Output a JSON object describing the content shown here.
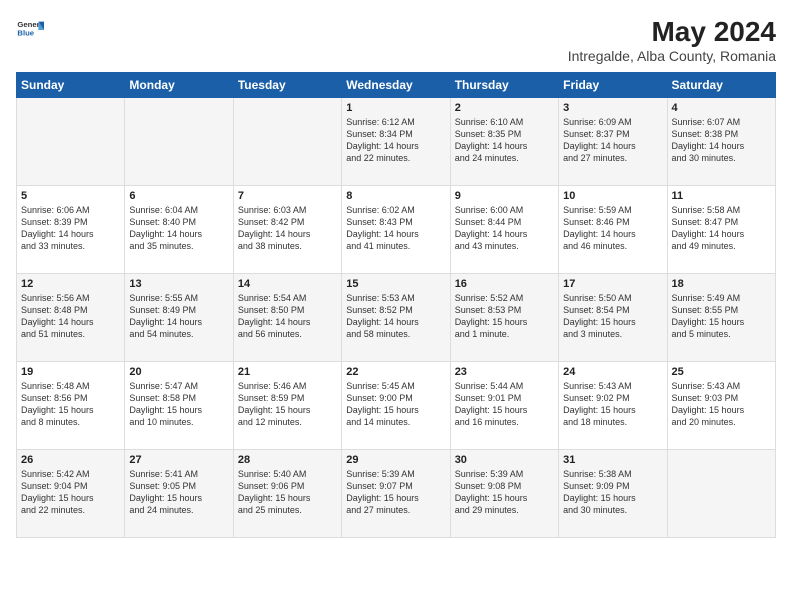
{
  "header": {
    "logo_general": "General",
    "logo_blue": "Blue",
    "title": "May 2024",
    "location": "Intregalde, Alba County, Romania"
  },
  "days_of_week": [
    "Sunday",
    "Monday",
    "Tuesday",
    "Wednesday",
    "Thursday",
    "Friday",
    "Saturday"
  ],
  "weeks": [
    [
      {
        "day": "",
        "info": ""
      },
      {
        "day": "",
        "info": ""
      },
      {
        "day": "",
        "info": ""
      },
      {
        "day": "1",
        "info": "Sunrise: 6:12 AM\nSunset: 8:34 PM\nDaylight: 14 hours\nand 22 minutes."
      },
      {
        "day": "2",
        "info": "Sunrise: 6:10 AM\nSunset: 8:35 PM\nDaylight: 14 hours\nand 24 minutes."
      },
      {
        "day": "3",
        "info": "Sunrise: 6:09 AM\nSunset: 8:37 PM\nDaylight: 14 hours\nand 27 minutes."
      },
      {
        "day": "4",
        "info": "Sunrise: 6:07 AM\nSunset: 8:38 PM\nDaylight: 14 hours\nand 30 minutes."
      }
    ],
    [
      {
        "day": "5",
        "info": "Sunrise: 6:06 AM\nSunset: 8:39 PM\nDaylight: 14 hours\nand 33 minutes."
      },
      {
        "day": "6",
        "info": "Sunrise: 6:04 AM\nSunset: 8:40 PM\nDaylight: 14 hours\nand 35 minutes."
      },
      {
        "day": "7",
        "info": "Sunrise: 6:03 AM\nSunset: 8:42 PM\nDaylight: 14 hours\nand 38 minutes."
      },
      {
        "day": "8",
        "info": "Sunrise: 6:02 AM\nSunset: 8:43 PM\nDaylight: 14 hours\nand 41 minutes."
      },
      {
        "day": "9",
        "info": "Sunrise: 6:00 AM\nSunset: 8:44 PM\nDaylight: 14 hours\nand 43 minutes."
      },
      {
        "day": "10",
        "info": "Sunrise: 5:59 AM\nSunset: 8:46 PM\nDaylight: 14 hours\nand 46 minutes."
      },
      {
        "day": "11",
        "info": "Sunrise: 5:58 AM\nSunset: 8:47 PM\nDaylight: 14 hours\nand 49 minutes."
      }
    ],
    [
      {
        "day": "12",
        "info": "Sunrise: 5:56 AM\nSunset: 8:48 PM\nDaylight: 14 hours\nand 51 minutes."
      },
      {
        "day": "13",
        "info": "Sunrise: 5:55 AM\nSunset: 8:49 PM\nDaylight: 14 hours\nand 54 minutes."
      },
      {
        "day": "14",
        "info": "Sunrise: 5:54 AM\nSunset: 8:50 PM\nDaylight: 14 hours\nand 56 minutes."
      },
      {
        "day": "15",
        "info": "Sunrise: 5:53 AM\nSunset: 8:52 PM\nDaylight: 14 hours\nand 58 minutes."
      },
      {
        "day": "16",
        "info": "Sunrise: 5:52 AM\nSunset: 8:53 PM\nDaylight: 15 hours\nand 1 minute."
      },
      {
        "day": "17",
        "info": "Sunrise: 5:50 AM\nSunset: 8:54 PM\nDaylight: 15 hours\nand 3 minutes."
      },
      {
        "day": "18",
        "info": "Sunrise: 5:49 AM\nSunset: 8:55 PM\nDaylight: 15 hours\nand 5 minutes."
      }
    ],
    [
      {
        "day": "19",
        "info": "Sunrise: 5:48 AM\nSunset: 8:56 PM\nDaylight: 15 hours\nand 8 minutes."
      },
      {
        "day": "20",
        "info": "Sunrise: 5:47 AM\nSunset: 8:58 PM\nDaylight: 15 hours\nand 10 minutes."
      },
      {
        "day": "21",
        "info": "Sunrise: 5:46 AM\nSunset: 8:59 PM\nDaylight: 15 hours\nand 12 minutes."
      },
      {
        "day": "22",
        "info": "Sunrise: 5:45 AM\nSunset: 9:00 PM\nDaylight: 15 hours\nand 14 minutes."
      },
      {
        "day": "23",
        "info": "Sunrise: 5:44 AM\nSunset: 9:01 PM\nDaylight: 15 hours\nand 16 minutes."
      },
      {
        "day": "24",
        "info": "Sunrise: 5:43 AM\nSunset: 9:02 PM\nDaylight: 15 hours\nand 18 minutes."
      },
      {
        "day": "25",
        "info": "Sunrise: 5:43 AM\nSunset: 9:03 PM\nDaylight: 15 hours\nand 20 minutes."
      }
    ],
    [
      {
        "day": "26",
        "info": "Sunrise: 5:42 AM\nSunset: 9:04 PM\nDaylight: 15 hours\nand 22 minutes."
      },
      {
        "day": "27",
        "info": "Sunrise: 5:41 AM\nSunset: 9:05 PM\nDaylight: 15 hours\nand 24 minutes."
      },
      {
        "day": "28",
        "info": "Sunrise: 5:40 AM\nSunset: 9:06 PM\nDaylight: 15 hours\nand 25 minutes."
      },
      {
        "day": "29",
        "info": "Sunrise: 5:39 AM\nSunset: 9:07 PM\nDaylight: 15 hours\nand 27 minutes."
      },
      {
        "day": "30",
        "info": "Sunrise: 5:39 AM\nSunset: 9:08 PM\nDaylight: 15 hours\nand 29 minutes."
      },
      {
        "day": "31",
        "info": "Sunrise: 5:38 AM\nSunset: 9:09 PM\nDaylight: 15 hours\nand 30 minutes."
      },
      {
        "day": "",
        "info": ""
      }
    ]
  ]
}
